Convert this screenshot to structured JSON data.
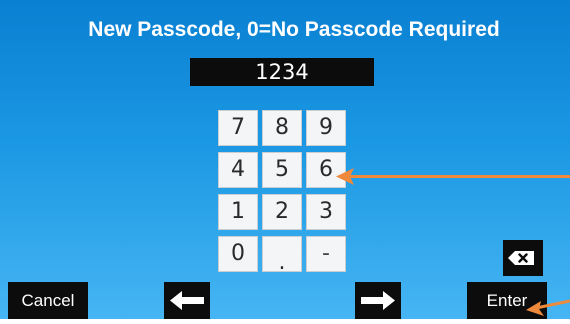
{
  "title": "New Passcode, 0=No Passcode Required",
  "entry": {
    "value": "1234"
  },
  "keypad": {
    "keys": [
      "7",
      "8",
      "9",
      "4",
      "5",
      "6",
      "1",
      "2",
      "3",
      "0",
      ".",
      "-"
    ]
  },
  "buttons": {
    "cancel_label": "Cancel",
    "enter_label": "Enter",
    "backspace_icon": "backspace-icon",
    "left_icon": "arrow-left-icon",
    "right_icon": "arrow-right-icon"
  },
  "colors": {
    "background_top": "#0a80d2",
    "background_bottom": "#46b5f3",
    "button_black": "#0c0c0c",
    "key_face": "#f3f5f6",
    "callout_orange": "#ef8a3c"
  }
}
